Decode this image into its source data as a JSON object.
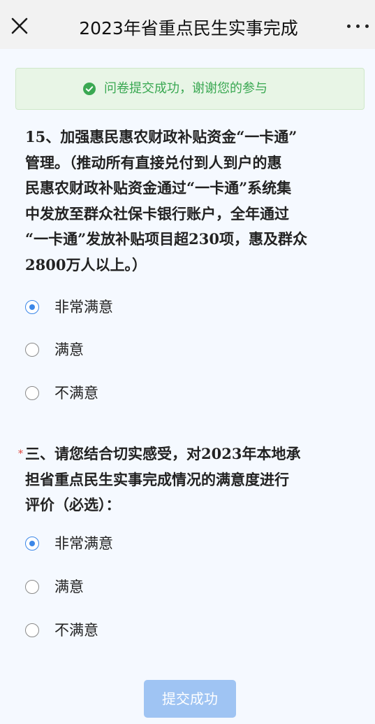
{
  "header": {
    "title": "2023年省重点民生实事完成"
  },
  "banner": {
    "text": "问卷提交成功，谢谢您的参与"
  },
  "questions": [
    {
      "required": "",
      "lines": [
        "15、加强惠民惠农财政补贴资金“一卡通”",
        "管理。（推动所有直接兑付到人到户的惠",
        "民惠农财政补贴资金通过“一卡通”系统集",
        "中发放至群众社保卡银行账户，全年通过",
        "“一卡通”发放补贴项目超230项，惠及群众",
        "2800万人以上。）"
      ],
      "options": [
        "非常满意",
        "满意",
        "不满意"
      ],
      "selected": "非常满意"
    },
    {
      "required": "*",
      "lines": [
        "三、请您结合切实感受，对2023年本地承",
        "担省重点民生实事完成情况的满意度进行",
        "评价（必选）："
      ],
      "options": [
        "非常满意",
        "满意",
        "不满意"
      ],
      "selected": "非常满意"
    }
  ],
  "submit": {
    "label": "提交成功"
  },
  "colors": {
    "accent": "#3b87e8",
    "success": "#3aa852",
    "required": "#e0443b",
    "submit_disabled": "#9fc4f3"
  }
}
